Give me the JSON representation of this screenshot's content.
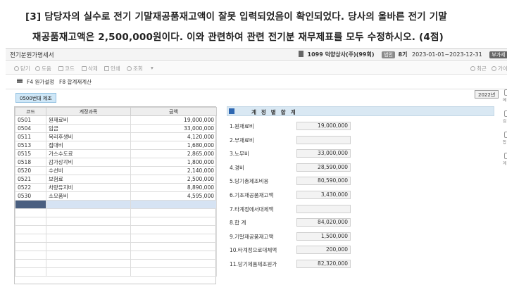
{
  "question": {
    "line1": "[3] 담당자의 실수로 전기 기말재공품재고액이 잘못 입력되었음이 확인되었다. 당사의 올바른 전기 기말",
    "line2": "재공품재고액은 2,500,000원이다. 이와 관련하여 관련 전기분 재무제표를 모두 수정하시오. (4점)"
  },
  "window": {
    "title": "전기분원가명세서",
    "company": "1099 덕양상사(주)(99회)",
    "period_tag": "법인",
    "period_num": "8기",
    "period_range": "2023-01-01~2023-12-31",
    "vat_tag": "부가세",
    "year": "2023"
  },
  "toolbar": {
    "close": "닫기",
    "help": "도움",
    "code": "코드",
    "delete": "삭제",
    "print": "인쇄",
    "search": "조회",
    "more": "▾",
    "refresh": "최근",
    "right_more": "가이"
  },
  "fnbar": {
    "f4": "F4 원가설정",
    "f8": "F8 합계재계산"
  },
  "subtab": "0500번대 제조",
  "year_button": "2022년",
  "grid": {
    "headers": [
      "코드",
      "계정과목",
      "금액"
    ],
    "rows": [
      {
        "code": "0501",
        "name": "원재료비",
        "amount": "19,000,000"
      },
      {
        "code": "0504",
        "name": "임금",
        "amount": "33,000,000"
      },
      {
        "code": "0511",
        "name": "복리후생비",
        "amount": "4,120,000"
      },
      {
        "code": "0513",
        "name": "접대비",
        "amount": "1,680,000"
      },
      {
        "code": "0515",
        "name": "가스수도료",
        "amount": "2,865,000"
      },
      {
        "code": "0518",
        "name": "감가상각비",
        "amount": "1,800,000"
      },
      {
        "code": "0520",
        "name": "수선비",
        "amount": "2,140,000"
      },
      {
        "code": "0521",
        "name": "보험료",
        "amount": "2,500,000"
      },
      {
        "code": "0522",
        "name": "차량유지비",
        "amount": "8,890,000"
      },
      {
        "code": "0530",
        "name": "소모품비",
        "amount": "4,595,000"
      }
    ]
  },
  "panel": {
    "title": "계정별합계",
    "rows": [
      {
        "label": "1.원재료비",
        "value": "19,000,000"
      },
      {
        "label": "2.부재료비",
        "value": ""
      },
      {
        "label": "3.노무비",
        "value": "33,000,000"
      },
      {
        "label": "4.경비",
        "value": "28,590,000"
      },
      {
        "label": "5.당기총제조비용",
        "value": "80,590,000"
      },
      {
        "label": "6.기초재공품재고액",
        "value": "3,430,000"
      },
      {
        "label": "7.타계정에서대체액",
        "value": ""
      },
      {
        "label": "8.합      계",
        "value": "84,020,000"
      },
      {
        "label": "9.기말재공품재고액",
        "value": "1,500,000"
      },
      {
        "label": "10.타계정으로대체액",
        "value": "200,000"
      },
      {
        "label": "11.당기제품제조원가",
        "value": "82,320,000"
      }
    ]
  },
  "side": {
    "a": "메",
    "b": "검",
    "c": "합",
    "d": "계"
  }
}
